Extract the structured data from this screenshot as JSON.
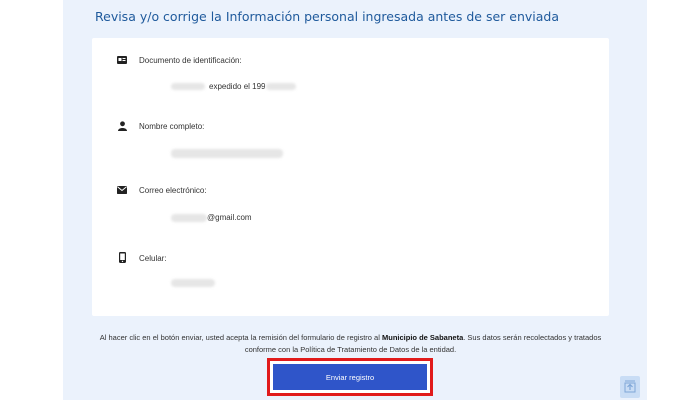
{
  "header": {
    "title": "Revisa y/o corrige la Información personal ingresada antes de ser enviada"
  },
  "fields": [
    {
      "icon": "id-card-icon",
      "label": "Documento de identificación:",
      "value": "expedido el 199"
    },
    {
      "icon": "user-icon",
      "label": "Nombre completo:",
      "value": ""
    },
    {
      "icon": "envelope-icon",
      "label": "Correo electrónico:",
      "value": "@gmail.com"
    },
    {
      "icon": "mobile-phone-icon",
      "label": "Celular:",
      "value": ""
    }
  ],
  "notice": {
    "part1": "Al hacer clic en el botón enviar, usted acepta la remisión del formulario de registro al ",
    "entity": "Municipio de Sabaneta",
    "part2": ". Sus datos serán recolectados y tratados conforme con la Política de Tratamiento de Datos de la entidad."
  },
  "actions": {
    "submit_label": "Enviar registro"
  },
  "colors": {
    "accent": "#2f55c9",
    "highlight": "#e11b1b",
    "heading": "#1f5a9c",
    "panel": "#ebf2fc"
  }
}
